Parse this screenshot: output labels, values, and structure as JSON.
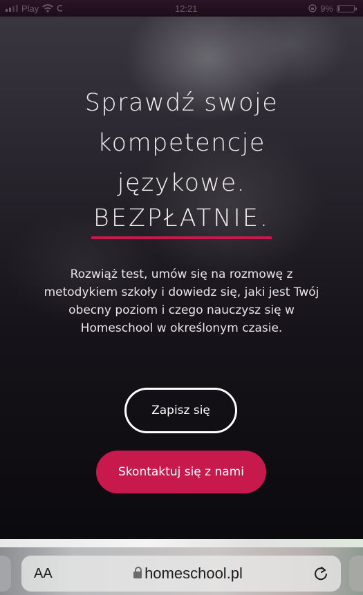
{
  "status_bar": {
    "carrier": "Play",
    "time": "12:21",
    "battery_percent": "9%",
    "battery_level": 0.09
  },
  "hero": {
    "headline_lines": [
      "Sprawdź swoje",
      "kompetencje",
      "językowe."
    ],
    "highlight": "BEZPŁATNIE.",
    "description_lines": [
      "Rozwiąż test, umów się na rozmowę z",
      "metodykiem szkoły i dowiedz się, jaki jest Twój",
      "obecny poziom i czego nauczysz się w",
      "Homeschool w określonym czasie."
    ],
    "signup_button": "Zapisz się",
    "contact_button": "Skontaktuj się z nami"
  },
  "browser": {
    "text_size_label": "AA",
    "url": "homeschool.pl",
    "icons": [
      "lock-icon",
      "reload-icon"
    ]
  },
  "colors": {
    "accent": "#c8194c",
    "background": "#0f0d12",
    "text": "#f4f1f3"
  }
}
